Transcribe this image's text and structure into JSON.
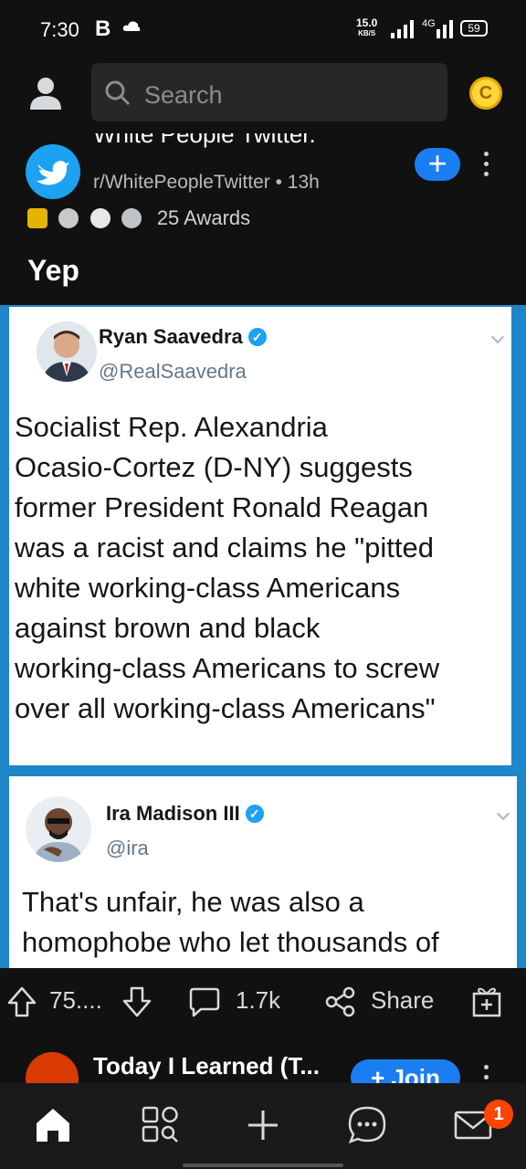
{
  "status_bar": {
    "time": "7:30",
    "carrier_glyph": "B",
    "net_speed_value": "15.0",
    "net_speed_unit": "KB/S",
    "network_type": "4G",
    "battery": "59"
  },
  "header": {
    "search_placeholder": "Search",
    "coin_label": "C"
  },
  "post": {
    "title_cut": "White People Twitter.",
    "subreddit": "r/WhitePeopleTwitter",
    "time_ago": "13h",
    "separator": "•",
    "awards_label": "25 Awards",
    "title": "Yep",
    "join_symbol": "+"
  },
  "tweets": [
    {
      "name": "Ryan Saavedra",
      "handle": "@RealSaavedra",
      "lines": [
        "Socialist Rep. Alexandria",
        "Ocasio-Cortez (D-NY) suggests",
        "former President Ronald Reagan",
        "was a racist and claims he \"pitted",
        "white working-class Americans",
        "against brown and black",
        "working-class Americans to screw",
        "over all working-class Americans\""
      ]
    },
    {
      "name": "Ira Madison III",
      "handle": "@ira",
      "lines": [
        "That's unfair, he was also a",
        "homophobe who let thousands of"
      ]
    }
  ],
  "actions": {
    "upvotes": "75....",
    "comments": "1.7k",
    "share": "Share"
  },
  "next_post": {
    "title": "Today I Learned (T...",
    "join": "+ Join"
  },
  "nav": {
    "inbox_badge": "1"
  },
  "colors": {
    "background": "#111111",
    "accent_blue": "#1a7ef2",
    "twitter_blue": "#1da1f2",
    "badge_orange": "#ff4500"
  }
}
